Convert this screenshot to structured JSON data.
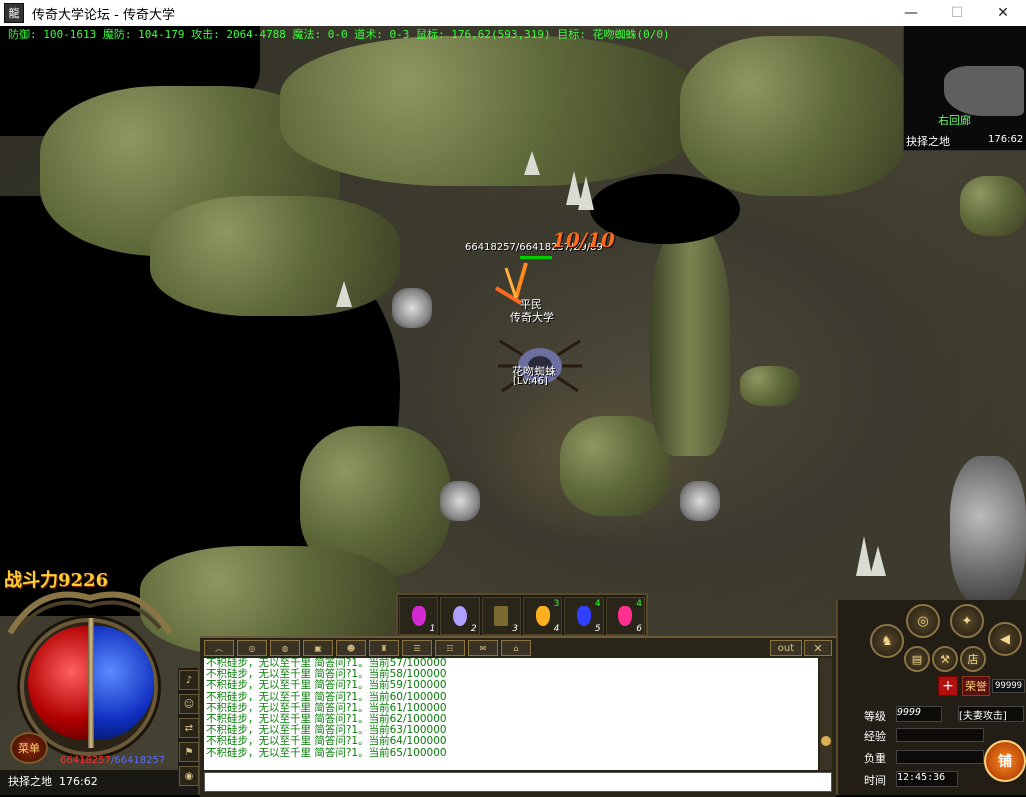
{
  "window": {
    "title": "传奇大学论坛 - 传奇大学",
    "icon_text": "龍",
    "minimize": "—",
    "maximize": "☐",
    "close": "✕"
  },
  "hud_top": {
    "stats": "防御: 100-1613 魔防: 104-179 攻击: 2064-4788 魔法: 0-0 道术: 0-3 鼠标: 176,62(593,319) 目标: 花吻蜘蛛(0/0)"
  },
  "minimap": {
    "zone_label": "右回廊",
    "map_name": "抉择之地",
    "coords": "176:62"
  },
  "world": {
    "monster_hp": "66418257/66418257/Z9/89",
    "damage_number": "10/10",
    "player_title": "平民",
    "player_guild": "传奇大学",
    "monster_name": "花吻蜘蛛",
    "monster_level": "[Lv:46]"
  },
  "power": {
    "label": "战斗力",
    "value": "9226"
  },
  "orb": {
    "menu_label": "菜单",
    "hp_text": "66418257",
    "mp_text": "/66418257"
  },
  "location": {
    "map": "抉择之地",
    "coords": "176:62"
  },
  "hotbar": [
    {
      "num": "1",
      "color": "#d02ad0",
      "count": ""
    },
    {
      "num": "2",
      "color": "#b0a0ff",
      "count": ""
    },
    {
      "num": "3",
      "color": "#7a6a30",
      "count": ""
    },
    {
      "num": "4",
      "color": "#ffb020",
      "count": "3"
    },
    {
      "num": "5",
      "color": "#3040ff",
      "count": "4"
    },
    {
      "num": "6",
      "color": "#ff3090",
      "count": "4"
    }
  ],
  "chat": {
    "out_label": "out",
    "close_label": "✕",
    "lines": [
      "不积硅步，无以至千里  简答问?1。当前57/100000",
      "不积硅步，无以至千里  简答问?1。当前58/100000",
      "不积硅步，无以至千里  简答问?1。当前59/100000",
      "不积硅步，无以至千里  简答问?1。当前60/100000",
      "不积硅步，无以至千里  简答问?1。当前61/100000",
      "不积硅步，无以至千里  简答问?1。当前62/100000",
      "不积硅步，无以至千里  简答问?1。当前63/100000",
      "不积硅步，无以至千里  简答问?1。当前64/100000",
      "不积硅步，无以至千里  简答问?1。当前65/100000"
    ]
  },
  "right_panel": {
    "honor_label": "荣誉",
    "honor_value": "99999",
    "level_label": "等级",
    "level_value": "9999",
    "mode": "[夫妻攻击]",
    "exp_label": "经验",
    "weight_label": "负重",
    "time_label": "时间",
    "time_value": "12:45:36",
    "shop_label": "铺"
  }
}
